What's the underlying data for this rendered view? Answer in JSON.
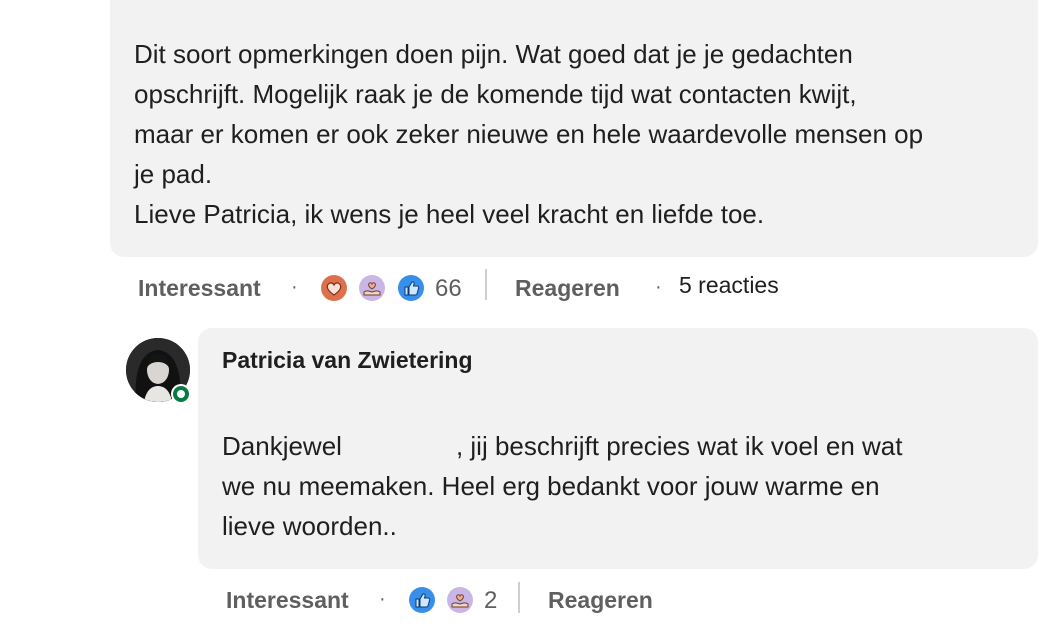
{
  "comment1": {
    "lines": [
      "Dit soort opmerkingen doen pijn. Wat goed dat je je gedachten",
      "opschrijft. Mogelijk raak je de komende tijd wat contacten kwijt,",
      "maar er komen er ook zeker nieuwe en hele waardevolle mensen op",
      "je pad.",
      "Lieve Patricia, ik wens je heel veel kracht en liefde toe."
    ],
    "actions": {
      "react_label": "Interessant",
      "separator": "·",
      "reactions": [
        "love-icon",
        "support-icon",
        "like-icon"
      ],
      "reaction_count": "66",
      "reply_label": "Reageren",
      "replies_label": "5 reacties"
    }
  },
  "reply": {
    "author": "Patricia van Zwietering",
    "lines": [
      "Dankjewel",
      ", jij beschrijft precies wat ik voel en wat",
      "we nu meemaken. Heel erg bedankt voor jouw warme en",
      "lieve woorden.."
    ],
    "actions": {
      "react_label": "Interessant",
      "separator": "·",
      "reactions": [
        "like-icon",
        "support-icon"
      ],
      "reaction_count": "2",
      "reply_label": "Reageren"
    }
  },
  "colors": {
    "bubble": "#f2f2f2",
    "online": "#0a7a44",
    "like": "#378fe9",
    "love": "#df704d",
    "support": "#c9b6e4"
  }
}
